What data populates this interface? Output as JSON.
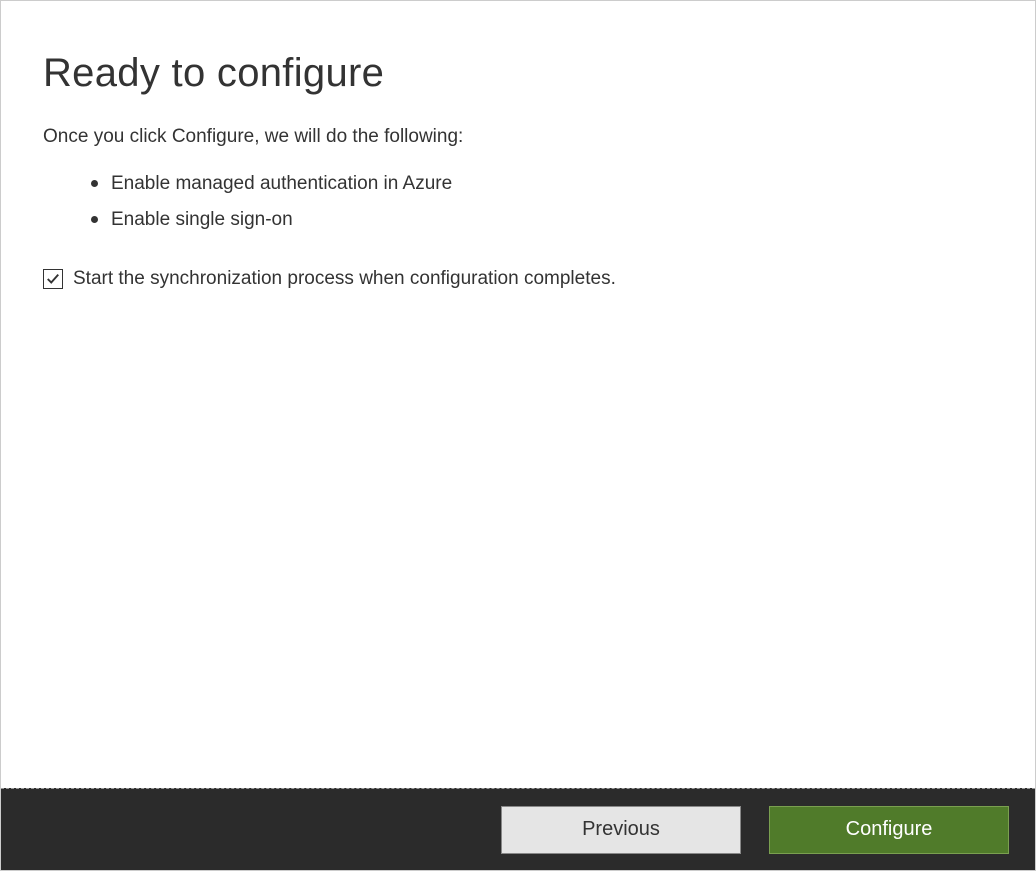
{
  "title": "Ready to configure",
  "intro": "Once you click Configure, we will do the following:",
  "actions": {
    "item0": "Enable managed authentication in Azure",
    "item1": "Enable single sign-on"
  },
  "checkbox": {
    "label": "Start the synchronization process when configuration completes.",
    "checked": true
  },
  "footer": {
    "previous": "Previous",
    "configure": "Configure"
  }
}
